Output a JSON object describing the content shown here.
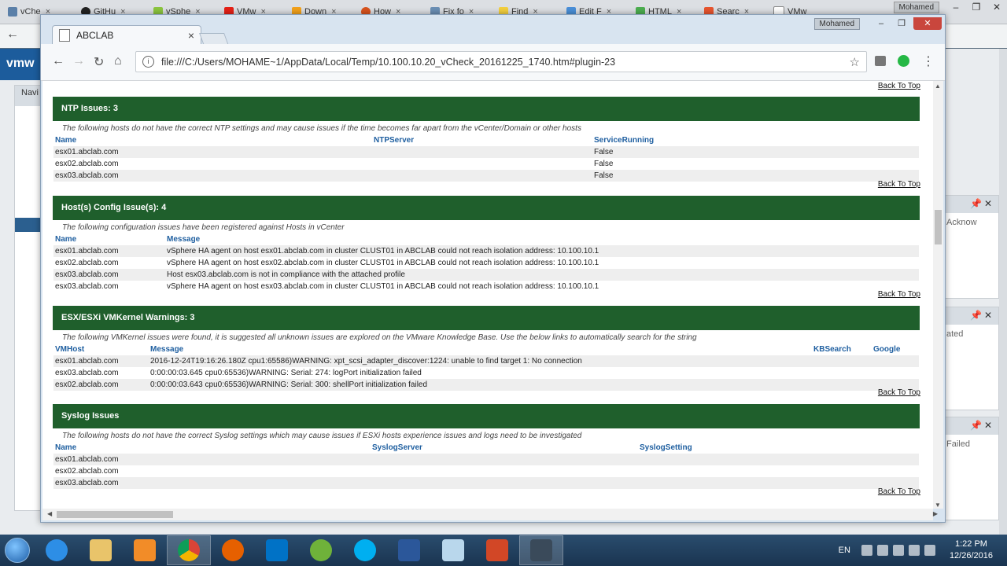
{
  "bg_tabs": [
    "vChe",
    "GitHu",
    "vSphe",
    "VMw",
    "Down",
    "How",
    "Fix fo",
    "Find",
    "Edit F",
    "HTML",
    "Searc",
    "VMw"
  ],
  "bg_user": "Mohamed",
  "bg_nav_label": "Navi",
  "bg_right_labels": [
    "Acknow",
    "ated",
    "Failed"
  ],
  "window": {
    "user": "Mohamed",
    "tab_title": "ABCLAB",
    "url": "file:///C:/Users/MOHAME~1/AppData/Local/Temp/10.100.10.20_vCheck_20161225_1740.htm#plugin-23"
  },
  "back_to_top": "Back To Top",
  "sections": [
    {
      "title": "NTP Issues: 3",
      "description": "The following hosts do not have the correct NTP settings and may cause issues if the time becomes far apart from the vCenter/Domain or other hosts",
      "columns": [
        "Name",
        "NTPServer",
        "ServiceRunning"
      ],
      "rows": [
        [
          "esx01.abclab.com",
          "",
          "False"
        ],
        [
          "esx02.abclab.com",
          "",
          "False"
        ],
        [
          "esx03.abclab.com",
          "",
          "False"
        ]
      ]
    },
    {
      "title": "Host(s) Config Issue(s): 4",
      "description": "The following configuration issues have been registered against Hosts in vCenter",
      "columns": [
        "Name",
        "Message"
      ],
      "rows": [
        [
          "esx01.abclab.com",
          "vSphere HA agent on host esx01.abclab.com in cluster CLUST01 in ABCLAB could not reach isolation address: 10.100.10.1"
        ],
        [
          "esx02.abclab.com",
          "vSphere HA agent on host esx02.abclab.com in cluster CLUST01 in ABCLAB could not reach isolation address: 10.100.10.1"
        ],
        [
          "esx03.abclab.com",
          "Host esx03.abclab.com is not in compliance with the attached profile"
        ],
        [
          "esx03.abclab.com",
          "vSphere HA agent on host esx03.abclab.com in cluster CLUST01 in ABCLAB could not reach isolation address: 10.100.10.1"
        ]
      ]
    },
    {
      "title": "ESX/ESXi VMKernel Warnings: 3",
      "description": "The following VMKernel issues were found, it is suggested all unknown issues are explored on the VMware Knowledge Base. Use the below links to automatically search for the string",
      "columns": [
        "VMHost",
        "Message",
        "KBSearch",
        "Google"
      ],
      "rows": [
        [
          "esx01.abclab.com",
          "2016-12-24T19:16:26.180Z cpu1:65586)WARNING: xpt_scsi_adapter_discover:1224: unable to find target 1: No connection",
          "",
          ""
        ],
        [
          "esx03.abclab.com",
          "0:00:00:03.645 cpu0:65536)WARNING: Serial: 274: logPort initialization failed",
          "",
          ""
        ],
        [
          "esx02.abclab.com",
          "0:00:00:03.643 cpu0:65536)WARNING: Serial: 300: shellPort initialization failed",
          "",
          ""
        ]
      ]
    },
    {
      "title": "Syslog Issues",
      "description": "The following hosts do not have the correct Syslog settings which may cause issues if ESXi hosts experience issues and logs need to be investigated",
      "columns": [
        "Name",
        "SyslogServer",
        "SyslogSetting"
      ],
      "rows": [
        [
          "esx01.abclab.com",
          "",
          ""
        ],
        [
          "esx02.abclab.com",
          "",
          ""
        ],
        [
          "esx03.abclab.com",
          "",
          ""
        ]
      ]
    }
  ],
  "taskbar": {
    "apps": [
      "start-orb",
      "internet-explorer",
      "file-explorer",
      "media-player",
      "chrome",
      "firefox",
      "outlook",
      "utorrent",
      "skype",
      "word",
      "notepad",
      "powerpoint",
      "snagit"
    ],
    "active_app": "chrome",
    "lang": "EN",
    "time": "1:22 PM",
    "date": "12/26/2016"
  },
  "colors": {
    "section_header": "#1f5f2c",
    "column_header_text": "#1f5fa0",
    "taskbar": "#2a4d6e"
  }
}
